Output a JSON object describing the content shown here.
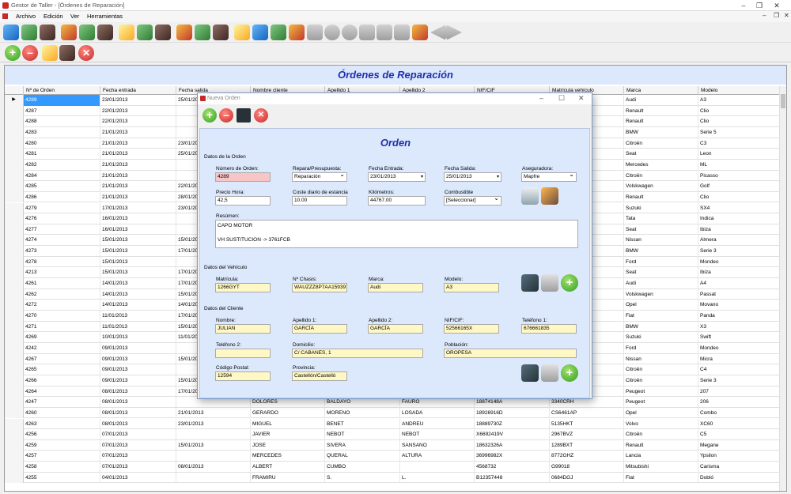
{
  "window": {
    "title": "Gestor de Taller - [Órdenes de Reparación]"
  },
  "menu": [
    "Archivo",
    "Edición",
    "Ver",
    "Herramientas"
  ],
  "main": {
    "title": "Órdenes de Reparación",
    "columns": [
      "Nº de Orden",
      "Fecha entrada",
      "Fecha salida",
      "Nombre cliente",
      "Apellido 1",
      "Apellido 2",
      "NIF/CIF",
      "Matrícula vehículo",
      "Marca",
      "Modelo"
    ],
    "rows": [
      [
        "4289",
        "23/01/2013",
        "25/01/2013",
        "",
        "",
        "",
        "",
        "",
        "Audi",
        "A3"
      ],
      [
        "4287",
        "22/01/2013",
        "",
        "",
        "",
        "",
        "",
        "",
        "Renault",
        "Clio"
      ],
      [
        "4288",
        "22/01/2013",
        "",
        "",
        "",
        "",
        "",
        "",
        "Renault",
        "Clio"
      ],
      [
        "4283",
        "21/01/2013",
        "",
        "",
        "",
        "",
        "",
        "",
        "BMW",
        "Serie 5"
      ],
      [
        "4280",
        "21/01/2013",
        "23/01/2013",
        "",
        "",
        "",
        "",
        "",
        "Citroën",
        "C3"
      ],
      [
        "4281",
        "21/01/2013",
        "25/01/2013",
        "",
        "",
        "",
        "",
        "",
        "Seat",
        "Leon"
      ],
      [
        "4282",
        "21/01/2013",
        "",
        "",
        "",
        "",
        "",
        "",
        "Mercedes",
        "ML"
      ],
      [
        "4284",
        "21/01/2013",
        "",
        "",
        "",
        "",
        "",
        "",
        "Citroën",
        "Picasso"
      ],
      [
        "4285",
        "21/01/2013",
        "22/01/2013",
        "",
        "",
        "",
        "",
        "",
        "Volskwagen",
        "Golf"
      ],
      [
        "4286",
        "21/01/2013",
        "28/01/2013",
        "",
        "",
        "",
        "",
        "",
        "Renault",
        "Clio"
      ],
      [
        "4279",
        "17/01/2013",
        "23/01/2013",
        "",
        "",
        "",
        "",
        "",
        "Suzuki",
        "SX4"
      ],
      [
        "4276",
        "16/01/2013",
        "",
        "",
        "",
        "",
        "",
        "",
        "Tata",
        "Indica"
      ],
      [
        "4277",
        "16/01/2013",
        "",
        "",
        "",
        "",
        "",
        "",
        "Seat",
        "Ibiza"
      ],
      [
        "4274",
        "15/01/2013",
        "15/01/2013",
        "",
        "",
        "",
        "",
        "",
        "Nissan",
        "Almera"
      ],
      [
        "4273",
        "15/01/2013",
        "17/01/2013",
        "",
        "",
        "",
        "",
        "",
        "BMW",
        "Serie 3"
      ],
      [
        "4278",
        "15/01/2013",
        "",
        "",
        "",
        "",
        "",
        "",
        "Ford",
        "Mondeo"
      ],
      [
        "4213",
        "15/01/2013",
        "17/01/2013",
        "",
        "",
        "",
        "",
        "",
        "Seat",
        "Ibiza"
      ],
      [
        "4261",
        "14/01/2013",
        "17/01/2013",
        "",
        "",
        "",
        "",
        "",
        "Audi",
        "A4"
      ],
      [
        "4262",
        "14/01/2013",
        "15/01/2013",
        "",
        "",
        "",
        "",
        "",
        "Volskwagen",
        "Passat"
      ],
      [
        "4272",
        "14/01/2013",
        "14/01/2013",
        "",
        "",
        "",
        "",
        "",
        "Opel",
        "Movano"
      ],
      [
        "4270",
        "11/01/2013",
        "17/01/2013",
        "",
        "",
        "",
        "",
        "",
        "Fiat",
        "Panda"
      ],
      [
        "4271",
        "11/01/2013",
        "15/01/2013",
        "",
        "",
        "",
        "",
        "",
        "BMW",
        "X3"
      ],
      [
        "4269",
        "10/01/2013",
        "11/01/2013",
        "",
        "",
        "",
        "",
        "",
        "Suzuki",
        "Swift"
      ],
      [
        "4242",
        "09/01/2013",
        "",
        "",
        "",
        "",
        "",
        "",
        "Ford",
        "Mondeo"
      ],
      [
        "4267",
        "09/01/2013",
        "15/01/2013",
        "",
        "",
        "",
        "",
        "",
        "Nissan",
        "Micra"
      ],
      [
        "4265",
        "09/01/2013",
        "",
        "",
        "",
        "",
        "",
        "",
        "Citroën",
        "C4"
      ],
      [
        "4266",
        "09/01/2013",
        "15/01/2013",
        "",
        "",
        "",
        "",
        "",
        "Citroën",
        "Serie 3"
      ],
      [
        "4264",
        "08/01/2013",
        "17/01/2013",
        "",
        "",
        "",
        "",
        "",
        "Peugeot",
        "207"
      ],
      [
        "4247",
        "08/01/2013",
        "",
        "DOLORES",
        "BALDAYO",
        "FAURO",
        "18874148A",
        "3340CRH",
        "Peugeot",
        "206"
      ],
      [
        "4260",
        "08/01/2013",
        "21/01/2013",
        "GERARDO",
        "MORENO",
        "LOSADA",
        "18926916D",
        "CS6461AP",
        "Opel",
        "Combo"
      ],
      [
        "4263",
        "08/01/2013",
        "23/01/2013",
        "MIGUEL",
        "BENET",
        "ANDREU",
        "18889730Z",
        "5135HKT",
        "Volvo",
        "XC60"
      ],
      [
        "4256",
        "07/01/2013",
        "",
        "JAVIER",
        "NEBOT",
        "NEBOT",
        "X6692419V",
        "2967BVZ",
        "Citroën",
        "C5"
      ],
      [
        "4259",
        "07/01/2013",
        "15/01/2013",
        "JOSE",
        "SIVERA",
        "SANSANO",
        "18632326A",
        "1289BXT",
        "Renault",
        "Megane"
      ],
      [
        "4257",
        "07/01/2013",
        "",
        "MERCEDES",
        "QUERAL",
        "ALTURA",
        "36996982X",
        "8772GHZ",
        "Lancia",
        "Ypsilon"
      ],
      [
        "4258",
        "07/01/2013",
        "08/01/2013",
        "ALBERT",
        "CUMBO",
        "",
        "4568732",
        "G99018",
        "Mitsubishi",
        "Carisma"
      ],
      [
        "4255",
        "04/01/2013",
        "",
        "FRAMIRU",
        "S.",
        "L.",
        "B12357448",
        "0684DGJ",
        "Fiat",
        "Dobló"
      ]
    ]
  },
  "dialog": {
    "title": "Nueva Orden",
    "heading": "Orden",
    "sec_orden": "Datos de la Orden",
    "sec_vehiculo": "Datos del Vehículo",
    "sec_cliente": "Datos del Cliente",
    "l_numero": "Número de Orden:",
    "v_numero": "4289",
    "l_repara": "Repara/Presupuesta:",
    "v_repara": "Reparación",
    "l_fentrada": "Fecha Entrada:",
    "v_fentrada": "23/01/2013",
    "l_fsalida": "Fecha Salida:",
    "v_fsalida": "25/01/2013",
    "l_aseg": "Aseguradora:",
    "v_aseg": "Mapfre",
    "l_precio": "Precio Hora:",
    "v_precio": "42,5",
    "l_coste": "Coste diario de estancia",
    "v_coste": "10.00",
    "l_km": "Kilómetros:",
    "v_km": "44767.00",
    "l_comb": "Combustible",
    "v_comb": "[Seleccionar]",
    "l_resumen": "Resúmen:",
    "v_resumen": "CAPO MOTOR\n\nVH SUSTITUCION -> 3761FCB",
    "l_matricula": "Matrícula:",
    "v_matricula": "1266GYT",
    "l_chasis": "Nº Chasis:",
    "v_chasis": "WAUZZZ8P7AA159397",
    "l_marca": "Marca:",
    "v_marca": "Audi",
    "l_modelo": "Modelo:",
    "v_modelo": "A3",
    "l_nombre": "Nombre:",
    "v_nombre": "JULIAN",
    "l_ap1": "Apellido 1:",
    "v_ap1": "GARCÍA",
    "l_ap2": "Apellido 2:",
    "v_ap2": "GARCÍA",
    "l_nif": "NIF/CIF:",
    "v_nif": "52566165X",
    "l_tel1": "Teléfono 1:",
    "v_tel1": "676661835",
    "l_tel2": "Teléfono 2:",
    "v_tel2": "",
    "l_dom": "Domicilio:",
    "v_dom": "C/ CABANES, 1",
    "l_pob": "Población:",
    "v_pob": "OROPESA",
    "l_cp": "Código Postal:",
    "v_cp": "12594",
    "l_prov": "Provincia:",
    "v_prov": "Castellón/Castelló"
  }
}
